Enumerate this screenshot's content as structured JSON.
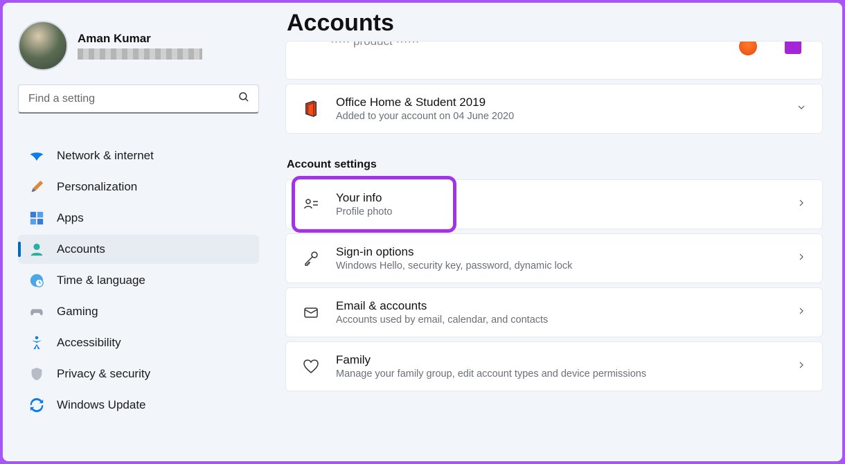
{
  "user": {
    "name": "Aman Kumar"
  },
  "search": {
    "placeholder": "Find a setting"
  },
  "nav": {
    "network": "Network & internet",
    "personalization": "Personalization",
    "apps": "Apps",
    "accounts": "Accounts",
    "time": "Time & language",
    "gaming": "Gaming",
    "accessibility": "Accessibility",
    "privacy": "Privacy & security",
    "update": "Windows Update"
  },
  "page": {
    "title": "Accounts",
    "section_label": "Account settings"
  },
  "cards": {
    "office": {
      "title": "Office Home & Student 2019",
      "sub": "Added to your account on 04 June 2020"
    },
    "your_info": {
      "title": "Your info",
      "sub": "Profile photo"
    },
    "signin": {
      "title": "Sign-in options",
      "sub": "Windows Hello, security key, password, dynamic lock"
    },
    "email": {
      "title": "Email & accounts",
      "sub": "Accounts used by email, calendar, and contacts"
    },
    "family": {
      "title": "Family",
      "sub": "Manage your family group, edit account types and device permissions"
    }
  }
}
